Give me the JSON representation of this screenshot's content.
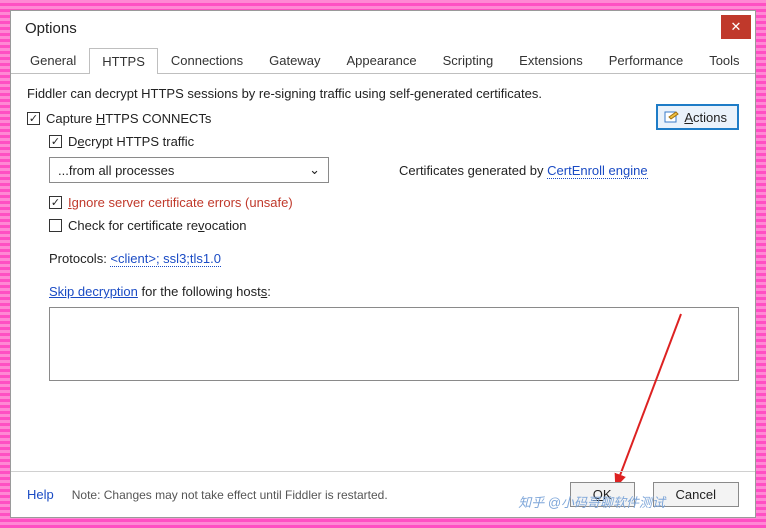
{
  "window": {
    "title": "Options"
  },
  "tabs": {
    "items": [
      "General",
      "HTTPS",
      "Connections",
      "Gateway",
      "Appearance",
      "Scripting",
      "Extensions",
      "Performance",
      "Tools"
    ],
    "active_index": 1
  },
  "body": {
    "intro": "Fiddler can decrypt HTTPS sessions by re-signing traffic using self-generated certificates.",
    "actions_label": "Actions",
    "capture_connects": {
      "checked": true,
      "label_pre": "Capture ",
      "label_u": "H",
      "label_post": "TTPS CONNECTs"
    },
    "decrypt": {
      "checked": true,
      "label_pre": "D",
      "label_u": "e",
      "label_post": "crypt HTTPS traffic"
    },
    "process_filter": {
      "value": "...from all processes"
    },
    "cert_gen_pre": "Certificates generated by ",
    "cert_gen_link": "CertEnroll engine",
    "ignore_errors": {
      "checked": true,
      "label_pre": "",
      "label_u": "I",
      "label_post": "gnore server certificate errors (unsafe)"
    },
    "check_revocation": {
      "checked": false,
      "label_pre": "Check for certificate re",
      "label_u": "v",
      "label_post": "ocation"
    },
    "protocols_label": "Protocols: ",
    "protocols_value": "<client>; ssl3;tls1.0",
    "skip_link": "Skip decryption",
    "skip_rest_pre": " for the following host",
    "skip_rest_u": "s",
    "skip_rest_post": ":"
  },
  "footer": {
    "help": "Help",
    "note": "Note: Changes may not take effect until Fiddler is restarted.",
    "ok_u": "O",
    "ok_post": "K",
    "cancel": "Cancel"
  },
  "watermark": "知乎 @小码哥聊软件测试"
}
